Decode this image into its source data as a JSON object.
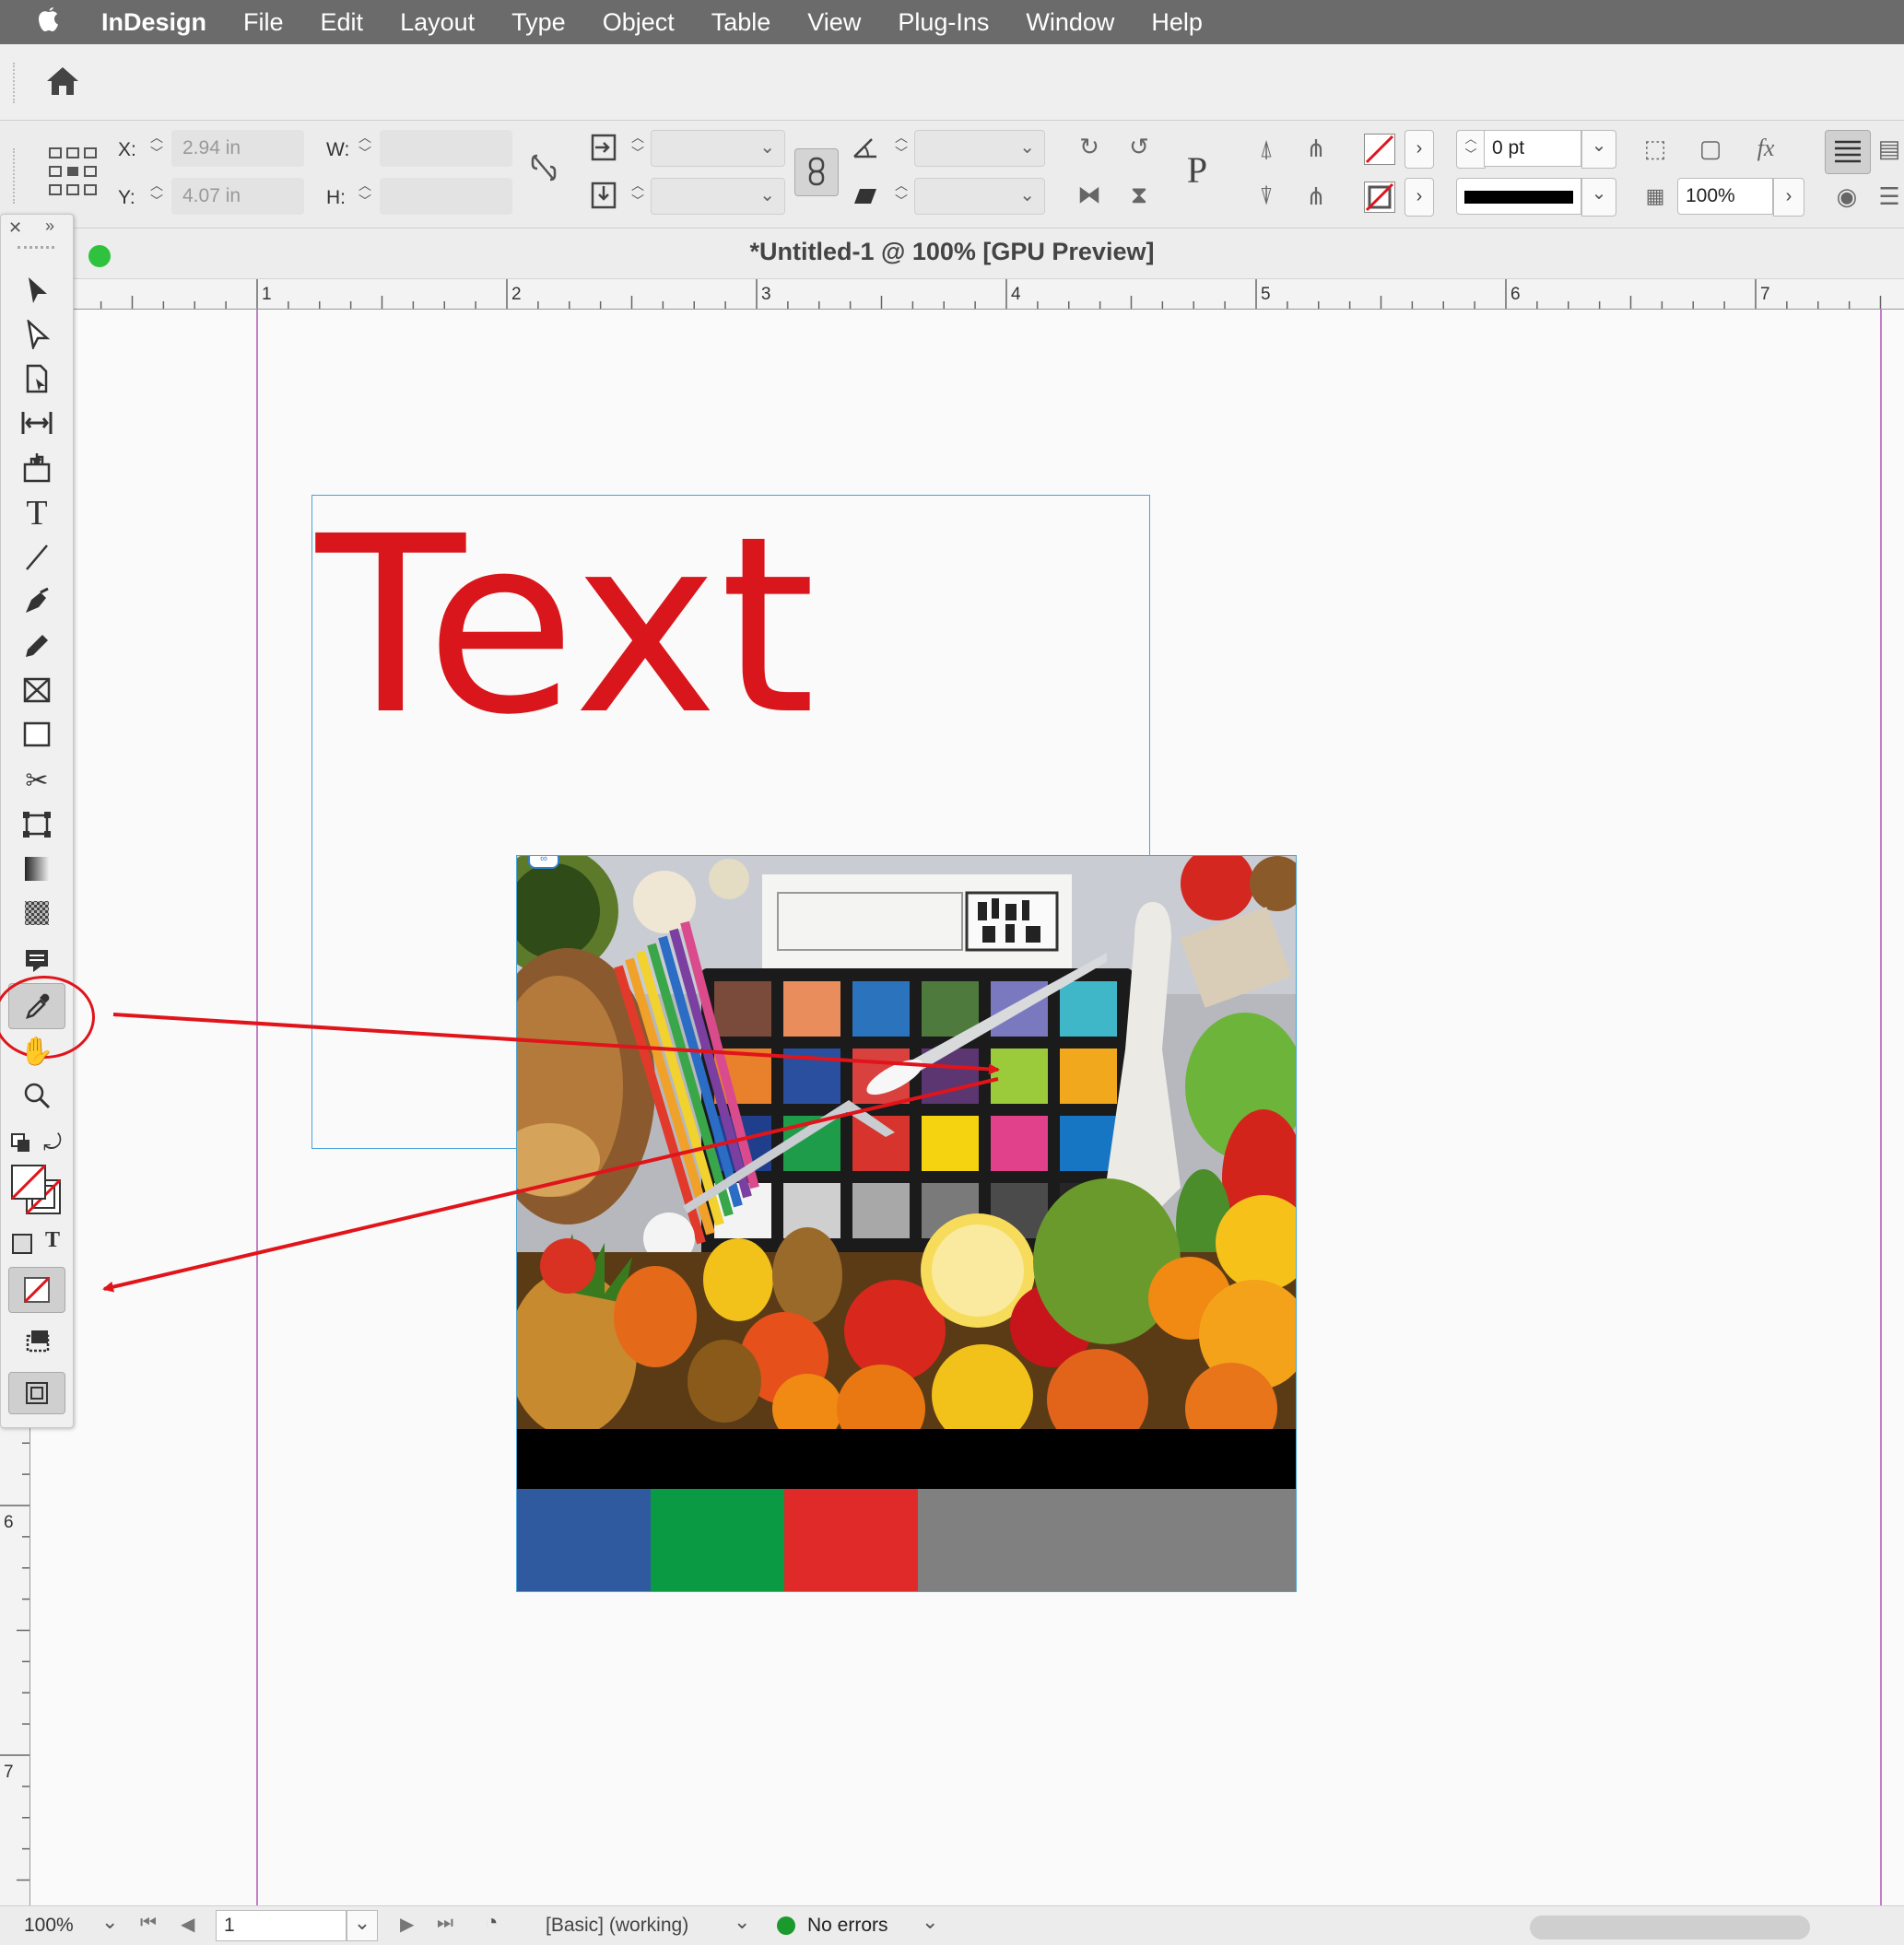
{
  "menubar": {
    "apple": "",
    "app": "InDesign",
    "items": [
      "File",
      "Edit",
      "Layout",
      "Type",
      "Object",
      "Table",
      "View",
      "Plug-Ins",
      "Window",
      "Help"
    ]
  },
  "control": {
    "x_label": "X:",
    "x_value": "2.94 in",
    "y_label": "Y:",
    "y_value": "4.07 in",
    "w_label": "W:",
    "h_label": "H:",
    "stroke_weight": "0 pt",
    "opacity": "100%",
    "frame_icon": "P"
  },
  "document": {
    "title": "*Untitled-1 @ 100% [GPU Preview]"
  },
  "rulers": {
    "h_numbers": [
      "1",
      "2",
      "3",
      "4",
      "5",
      "6",
      "7"
    ],
    "v_numbers": [
      "6",
      "7"
    ]
  },
  "page": {
    "text_frame": "Text",
    "text_color": "#d9161c",
    "swatches": [
      "#2f5aa0",
      "#0b9a44",
      "#e02a29",
      "#808080"
    ],
    "chart_colors": [
      "#7a4a3a",
      "#e98d5c",
      "#2b73bd",
      "#4e7a3e",
      "#7a79c0",
      "#3fb7c9",
      "#e9802b",
      "#2a4f9e",
      "#d9413e",
      "#5c3670",
      "#9bcb3b",
      "#f1a81c",
      "#1f3f8c",
      "#1f9c4a",
      "#d6342d",
      "#f5d310",
      "#e0418a",
      "#1776c4",
      "#f3f3f3",
      "#cfcfcf",
      "#a8a8a8",
      "#7a7a7a",
      "#4b4b4b",
      "#262626"
    ]
  },
  "statusbar": {
    "zoom": "100%",
    "page": "1",
    "preflight_profile": "[Basic] (working)",
    "errors": "No errors"
  },
  "colors": {
    "accent_red": "#e0141a",
    "frame_blue": "#4aa3d8",
    "margin_purple": "#c27fc7",
    "status_green": "#1a9a2c"
  }
}
